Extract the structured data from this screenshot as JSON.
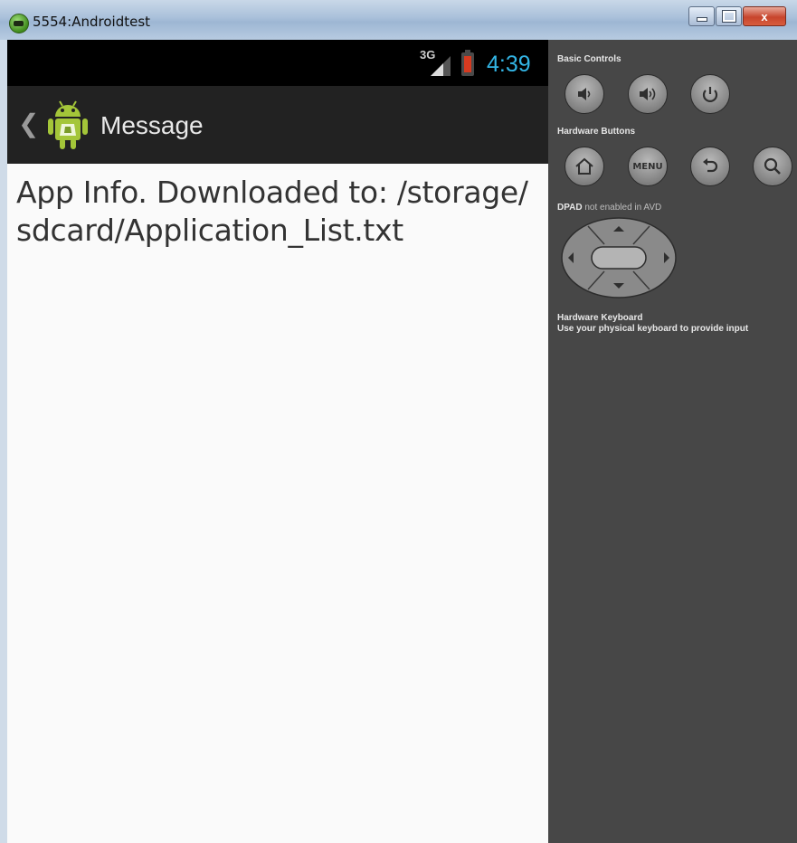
{
  "window": {
    "title": "5554:Androidtest",
    "icons": [
      "android-emulator-icon",
      "minimize-icon",
      "maximize-icon",
      "close-icon"
    ],
    "close_glyph": "x"
  },
  "statusbar": {
    "network": "3G",
    "clock": "4:39",
    "clock_color": "#33b5e5"
  },
  "actionbar": {
    "title": "Message",
    "icons": [
      "back-chevron-icon",
      "android-app-icon"
    ]
  },
  "content": {
    "message": "App Info. Downloaded to: /storage/ sdcard/Application_List.txt"
  },
  "controls": {
    "basic_controls_label": "Basic Controls",
    "hardware_buttons_label": "Hardware Buttons",
    "dpad_label_bold": "DPAD",
    "dpad_label_rest": " not enabled in AVD",
    "menu_label": "MENU",
    "keyboard_title": "Hardware Keyboard",
    "keyboard_hint": "Use your physical keyboard to provide input",
    "buttons": [
      "volume-down-icon",
      "volume-up-icon",
      "power-icon",
      "home-icon",
      "menu-icon",
      "back-icon",
      "search-icon"
    ]
  }
}
